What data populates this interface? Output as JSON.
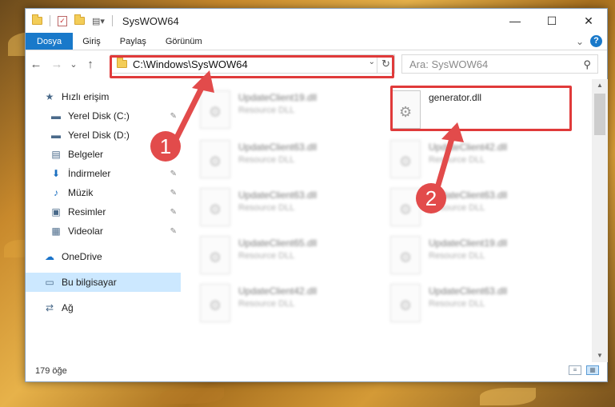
{
  "window": {
    "title": "SysWOW64",
    "min": "—",
    "max": "☐",
    "close": "✕"
  },
  "ribbon": {
    "tabs": [
      "Dosya",
      "Giriş",
      "Paylaş",
      "Görünüm"
    ],
    "expand": "⌄",
    "help": "?"
  },
  "nav": {
    "back": "←",
    "forward": "→",
    "recent": "⌄",
    "up": "↑"
  },
  "address": {
    "path": "C:\\Windows\\SysWOW64",
    "dropdown": "⌄",
    "refresh": "↻"
  },
  "search": {
    "placeholder": "Ara: SysWOW64",
    "icon": "⚲"
  },
  "sidebar": {
    "items": [
      {
        "label": "Hızlı erişim",
        "icon": "star-icon",
        "glyph": "★",
        "pinned": false
      },
      {
        "label": "Yerel Disk (C:)",
        "icon": "drive-icon",
        "glyph": "▬",
        "pinned": true
      },
      {
        "label": "Yerel Disk (D:)",
        "icon": "drive-icon",
        "glyph": "▬",
        "pinned": false
      },
      {
        "label": "Belgeler",
        "icon": "documents-icon",
        "glyph": "▤",
        "pinned": false
      },
      {
        "label": "İndirmeler",
        "icon": "downloads-icon",
        "glyph": "⬇",
        "pinned": true
      },
      {
        "label": "Müzik",
        "icon": "music-icon",
        "glyph": "♪",
        "pinned": true
      },
      {
        "label": "Resimler",
        "icon": "pictures-icon",
        "glyph": "▣",
        "pinned": true
      },
      {
        "label": "Videolar",
        "icon": "videos-icon",
        "glyph": "▦",
        "pinned": true
      },
      {
        "label": "OneDrive",
        "icon": "onedrive-icon",
        "glyph": "☁",
        "pinned": false
      },
      {
        "label": "Bu bilgisayar",
        "icon": "computer-icon",
        "glyph": "▭",
        "pinned": false,
        "selected": true
      },
      {
        "label": "Ağ",
        "icon": "network-icon",
        "glyph": "⇄",
        "pinned": false
      }
    ],
    "pin_glyph": "📌"
  },
  "files": [
    {
      "name": "UpdateClient19.dll",
      "type": "Resource DLL",
      "blurred": true
    },
    {
      "name": "generator.dll",
      "type": "",
      "blurred": false
    },
    {
      "name": "UpdateClient63.dll",
      "type": "Resource DLL",
      "blurred": true
    },
    {
      "name": "UpdateClient42.dll",
      "type": "Resource DLL",
      "blurred": true
    },
    {
      "name": "UpdateClient63.dll",
      "type": "Resource DLL",
      "blurred": true
    },
    {
      "name": "UpdateClient63.dll",
      "type": "Resource DLL",
      "blurred": true
    },
    {
      "name": "UpdateClient65.dll",
      "type": "Resource DLL",
      "blurred": true
    },
    {
      "name": "UpdateClient19.dll",
      "type": "Resource DLL",
      "blurred": true
    },
    {
      "name": "UpdateClient42.dll",
      "type": "Resource DLL",
      "blurred": true
    },
    {
      "name": "UpdateClient63.dll",
      "type": "Resource DLL",
      "blurred": true
    }
  ],
  "status": {
    "count": "179 öğe"
  },
  "callouts": [
    "1",
    "2"
  ],
  "colors": {
    "accent": "#1979ca",
    "highlight": "#e03a3a",
    "selected": "#cce8ff"
  }
}
